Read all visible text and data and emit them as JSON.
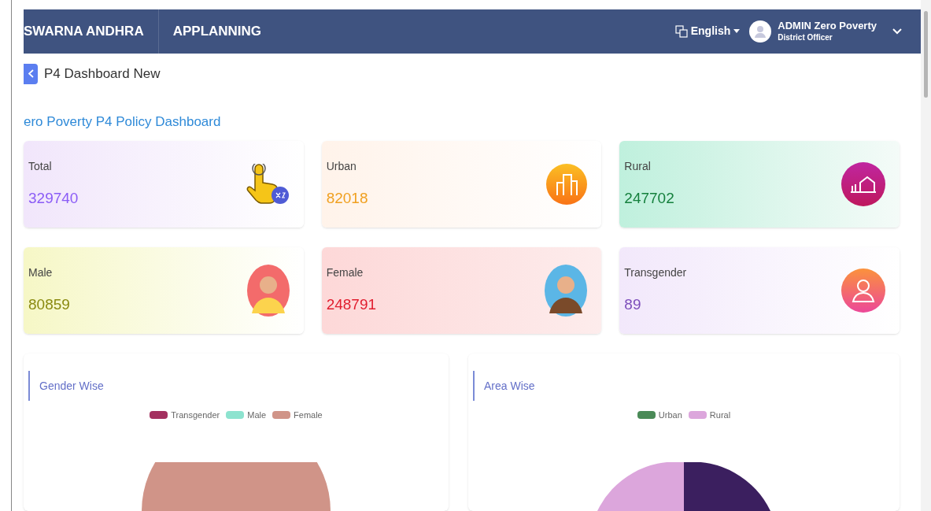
{
  "header": {
    "nav": [
      "SWARNA ANDHRA",
      "APPLANNING"
    ],
    "language": "English",
    "user": {
      "name": "ADMIN Zero Poverty",
      "role": "District Officer"
    }
  },
  "page_title": "P4 Dashboard New",
  "dashboard_title": "ero Poverty P4 Policy Dashboard",
  "cards": [
    {
      "kind": "total",
      "label": "Total",
      "value": "329740",
      "color": "#8b5cf6"
    },
    {
      "kind": "urban",
      "label": "Urban",
      "value": "82018",
      "color": "#f0a020"
    },
    {
      "kind": "rural",
      "label": "Rural",
      "value": "247702",
      "color": "#15803d"
    },
    {
      "kind": "male",
      "label": "Male",
      "value": "80859",
      "color": "#8a8a10"
    },
    {
      "kind": "female",
      "label": "Female",
      "value": "248791",
      "color": "#e11d2e"
    },
    {
      "kind": "transgender",
      "label": "Transgender",
      "value": "89",
      "color": "#7c4dbb"
    }
  ],
  "charts": [
    {
      "kind": "gender",
      "title": "Gender Wise",
      "legend": [
        {
          "label": "Transgender",
          "color": "#a3305f"
        },
        {
          "label": "Male",
          "color": "#8de3cf"
        },
        {
          "label": "Female",
          "color": "#d09488"
        }
      ]
    },
    {
      "kind": "area",
      "title": "Area Wise",
      "legend": [
        {
          "label": "Urban",
          "color": "#4a8a57"
        },
        {
          "label": "Rural",
          "color": "#dca6dc"
        }
      ]
    }
  ]
}
